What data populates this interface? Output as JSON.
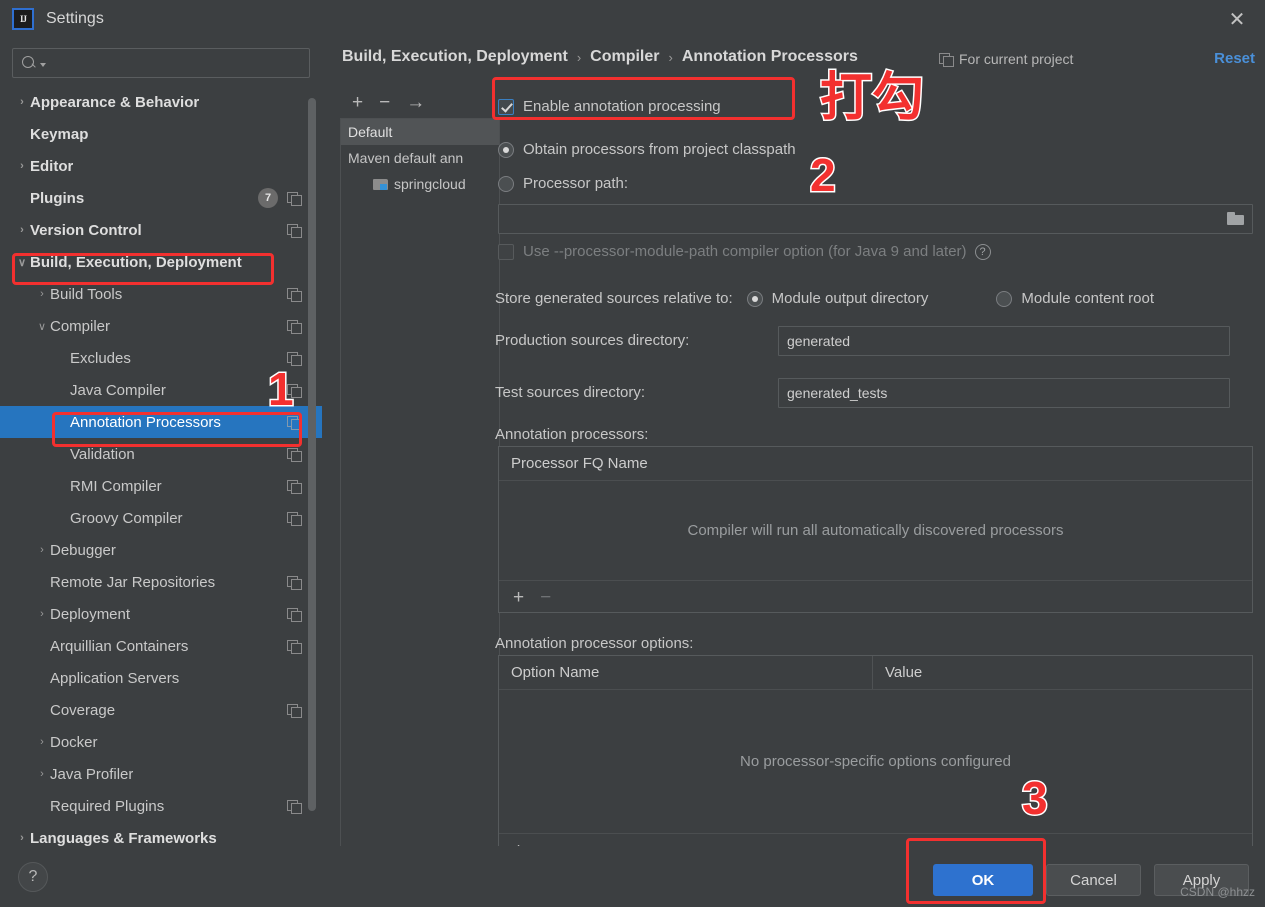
{
  "window": {
    "title": "Settings",
    "logo_text": "IJ",
    "close_label": "✕"
  },
  "sidebar": {
    "search": {
      "value": "",
      "placeholder": ""
    },
    "items": [
      {
        "label": "Appearance & Behavior",
        "arrow": "›",
        "indent": 1,
        "bold": true,
        "badge": "",
        "copy": false,
        "selected": false
      },
      {
        "label": "Keymap",
        "arrow": "",
        "indent": 1,
        "bold": true,
        "badge": "",
        "copy": false,
        "selected": false
      },
      {
        "label": "Editor",
        "arrow": "›",
        "indent": 1,
        "bold": true,
        "badge": "",
        "copy": false,
        "selected": false
      },
      {
        "label": "Plugins",
        "arrow": "",
        "indent": 1,
        "bold": true,
        "badge": "7",
        "copy": true,
        "selected": false
      },
      {
        "label": "Version Control",
        "arrow": "›",
        "indent": 1,
        "bold": true,
        "badge": "",
        "copy": true,
        "selected": false
      },
      {
        "label": "Build, Execution, Deployment",
        "arrow": "∨",
        "indent": 1,
        "bold": true,
        "badge": "",
        "copy": false,
        "selected": false
      },
      {
        "label": "Build Tools",
        "arrow": "›",
        "indent": 2,
        "bold": false,
        "badge": "",
        "copy": true,
        "selected": false
      },
      {
        "label": "Compiler",
        "arrow": "∨",
        "indent": 2,
        "bold": false,
        "badge": "",
        "copy": true,
        "selected": false
      },
      {
        "label": "Excludes",
        "arrow": "",
        "indent": 3,
        "bold": false,
        "badge": "",
        "copy": true,
        "selected": false
      },
      {
        "label": "Java Compiler",
        "arrow": "",
        "indent": 3,
        "bold": false,
        "badge": "",
        "copy": true,
        "selected": false
      },
      {
        "label": "Annotation Processors",
        "arrow": "",
        "indent": 3,
        "bold": false,
        "badge": "",
        "copy": true,
        "selected": true
      },
      {
        "label": "Validation",
        "arrow": "",
        "indent": 3,
        "bold": false,
        "badge": "",
        "copy": true,
        "selected": false
      },
      {
        "label": "RMI Compiler",
        "arrow": "",
        "indent": 3,
        "bold": false,
        "badge": "",
        "copy": true,
        "selected": false
      },
      {
        "label": "Groovy Compiler",
        "arrow": "",
        "indent": 3,
        "bold": false,
        "badge": "",
        "copy": true,
        "selected": false
      },
      {
        "label": "Debugger",
        "arrow": "›",
        "indent": 2,
        "bold": false,
        "badge": "",
        "copy": false,
        "selected": false
      },
      {
        "label": "Remote Jar Repositories",
        "arrow": "",
        "indent": 2,
        "bold": false,
        "badge": "",
        "copy": true,
        "selected": false
      },
      {
        "label": "Deployment",
        "arrow": "›",
        "indent": 2,
        "bold": false,
        "badge": "",
        "copy": true,
        "selected": false
      },
      {
        "label": "Arquillian Containers",
        "arrow": "",
        "indent": 2,
        "bold": false,
        "badge": "",
        "copy": true,
        "selected": false
      },
      {
        "label": "Application Servers",
        "arrow": "",
        "indent": 2,
        "bold": false,
        "badge": "",
        "copy": false,
        "selected": false
      },
      {
        "label": "Coverage",
        "arrow": "",
        "indent": 2,
        "bold": false,
        "badge": "",
        "copy": true,
        "selected": false
      },
      {
        "label": "Docker",
        "arrow": "›",
        "indent": 2,
        "bold": false,
        "badge": "",
        "copy": false,
        "selected": false
      },
      {
        "label": "Java Profiler",
        "arrow": "›",
        "indent": 2,
        "bold": false,
        "badge": "",
        "copy": false,
        "selected": false
      },
      {
        "label": "Required Plugins",
        "arrow": "",
        "indent": 2,
        "bold": false,
        "badge": "",
        "copy": true,
        "selected": false
      },
      {
        "label": "Languages & Frameworks",
        "arrow": "›",
        "indent": 1,
        "bold": true,
        "badge": "",
        "copy": false,
        "selected": false
      }
    ]
  },
  "breadcrumb": {
    "part1": "Build, Execution, Deployment",
    "part2": "Compiler",
    "part3": "Annotation Processors",
    "separator": "›"
  },
  "header": {
    "for_project": "For current project",
    "reset": "Reset"
  },
  "profiles": {
    "toolbar": {
      "add": "+",
      "remove": "−",
      "move": "→"
    },
    "items": [
      {
        "label": "Default",
        "selected": true,
        "child": false
      },
      {
        "label": "Maven default ann",
        "selected": false,
        "child": false
      },
      {
        "label": "springcloud",
        "selected": false,
        "child": true
      }
    ]
  },
  "form": {
    "enable_annotation_processing": "Enable annotation processing",
    "enable_checked": true,
    "obtain_from_classpath": "Obtain processors from project classpath",
    "obtain_selected": true,
    "processor_path_label": "Processor path:",
    "processor_path_selected": false,
    "processor_path_value": "",
    "use_module_path": "Use --processor-module-path compiler option (for Java 9 and later)",
    "use_module_path_checked": false,
    "help_glyph": "?",
    "store_label": "Store generated sources relative to:",
    "store_option_1": "Module output directory",
    "store_option_1_selected": true,
    "store_option_2": "Module content root",
    "store_option_2_selected": false,
    "production_label": "Production sources directory:",
    "production_value": "generated",
    "test_label": "Test sources directory:",
    "test_value": "generated_tests",
    "processors_label": "Annotation processors:",
    "processors_header": "Processor FQ Name",
    "processors_empty": "Compiler will run all automatically discovered processors",
    "processors_add": "+",
    "processors_remove": "−",
    "options_label": "Annotation processor options:",
    "options_header_name": "Option Name",
    "options_header_value": "Value",
    "options_empty": "No processor-specific options configured",
    "options_add": "+",
    "options_remove": "−"
  },
  "footer": {
    "help": "?",
    "ok": "OK",
    "cancel": "Cancel",
    "apply": "Apply"
  },
  "annotations": {
    "step1": "1",
    "step2": "2",
    "step3": "3",
    "check_hint": "打勾"
  },
  "watermark": "CSDN @hhzz",
  "colors": {
    "accent": "#2675bf",
    "annotation_red": "#f3302f",
    "link": "#4a90d9",
    "background": "#3c3f41"
  }
}
